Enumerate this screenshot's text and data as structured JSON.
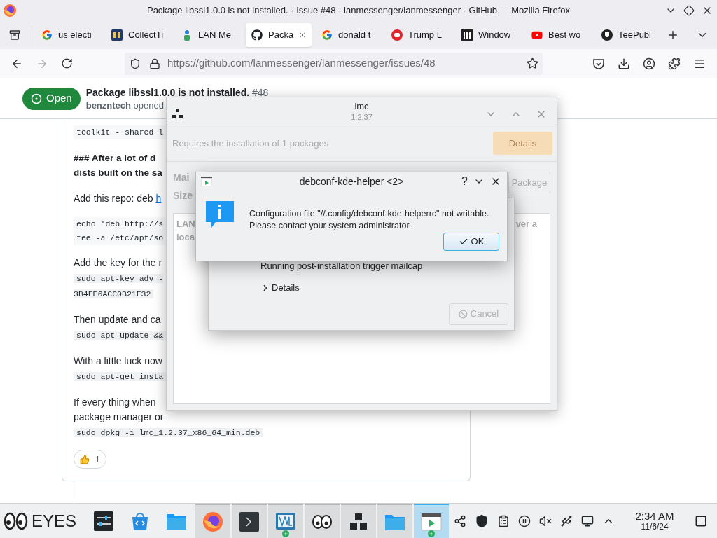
{
  "browser": {
    "title": "Package libssl1.0.0 is not installed. · Issue #48 · lanmessenger/lanmessenger · GitHub — Mozilla Firefox",
    "tabs": [
      {
        "label": "us electi",
        "kind": "g",
        "selected": false
      },
      {
        "label": "CollectTi",
        "kind": "number",
        "selected": false
      },
      {
        "label": "LAN Me",
        "kind": "figure",
        "selected": false
      },
      {
        "label": "Packa",
        "kind": "cat",
        "selected": true
      },
      {
        "label": "donald t",
        "kind": "g",
        "selected": false
      },
      {
        "label": "Trump L",
        "kind": "record",
        "selected": false
      },
      {
        "label": "Window",
        "kind": "pillars",
        "selected": false
      },
      {
        "label": "Best wo",
        "kind": "play",
        "selected": false
      },
      {
        "label": "TeePubl",
        "kind": "tee",
        "selected": false
      }
    ],
    "forward": {
      "disabled": true
    },
    "url": "https://github.com/lanmessenger/lanmessenger/issues/48"
  },
  "issue": {
    "status": "Open",
    "title": "Package libssl1.0.0 is not installed.",
    "number": "#48",
    "byline": "**benzntech** opened",
    "body": [
      {
        "kind": "code",
        "text": "toolkit - shared l"
      },
      {
        "kind": "heading",
        "text": "### After a lot of d\ndists built on the sa"
      },
      {
        "kind": "link",
        "text": "Add this repo: deb ",
        "link": "h"
      },
      {
        "kind": "code",
        "text": "echo 'deb http://s\ntee -a /etc/apt/so"
      },
      {
        "kind": "text",
        "text": "Add the key for the r"
      },
      {
        "kind": "inline-code",
        "text": "sudo apt-key adv -\n3B4FE6ACC0B21F32"
      },
      {
        "kind": "text",
        "text": "Then update and ca"
      },
      {
        "kind": "inline-code",
        "text": "sudo apt update &&"
      },
      {
        "kind": "text",
        "text": "With a little luck now"
      },
      {
        "kind": "inline-code",
        "text": "sudo apt-get insta"
      },
      {
        "kind": "text",
        "text": "If every thing when\npackage manager or"
      },
      {
        "kind": "inline-code",
        "text": "sudo dpkg -i lmc_1.2.37_x86_64_min.deb"
      }
    ],
    "reaction_count": "1"
  },
  "lmc": {
    "title": "lmc",
    "version": "1.2.37",
    "summary": "Requires the installation of 1 packages",
    "details_button": {
      "label": "Details",
      "disabled": true
    },
    "field_labels": [
      "Mai",
      "Size"
    ],
    "package_button": {
      "label": "Package",
      "disabled": true
    },
    "description_left": "LAN\nloca",
    "description_right": "ver a"
  },
  "progress": {
    "status": "Running post-installation trigger mailcap",
    "details": "Details",
    "expanded": false,
    "cancel": {
      "label": "Cancel",
      "disabled": true
    }
  },
  "debconf": {
    "title": "debconf-kde-helper <2>",
    "help": "?",
    "message": "Configuration file \"//.config/debconf-kde-helperrc\" not writable.\nPlease contact your system administrator.",
    "ok": "OK"
  },
  "taskbar": {
    "label": "EYES",
    "items": [
      {
        "kind": "sliders",
        "open": false,
        "selected": false,
        "grouped": false
      },
      {
        "kind": "store",
        "open": false,
        "selected": false,
        "grouped": false
      },
      {
        "kind": "folder",
        "open": false,
        "selected": false,
        "grouped": false
      },
      {
        "kind": "fox",
        "open": true,
        "selected": false,
        "grouped": false
      },
      {
        "kind": "terminal",
        "open": true,
        "selected": false,
        "grouped": false
      },
      {
        "kind": "monitor",
        "open": true,
        "selected": false,
        "grouped": true
      },
      {
        "kind": "eyes",
        "open": true,
        "selected": false,
        "grouped": false
      },
      {
        "kind": "blocks",
        "open": true,
        "selected": false,
        "grouped": false
      },
      {
        "kind": "folder",
        "open": true,
        "selected": false,
        "grouped": false
      },
      {
        "kind": "dialog",
        "open": true,
        "selected": true,
        "grouped": true
      }
    ],
    "time": "2:34 AM",
    "date": "11/6/24"
  }
}
